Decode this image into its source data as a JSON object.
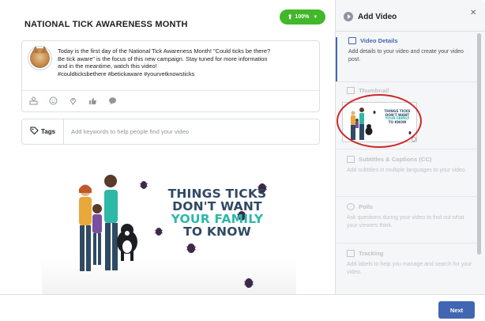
{
  "post": {
    "title": "NATIONAL TICK AWARENESS MONTH",
    "upload_progress": "100%",
    "upload_progress_value": 1.0,
    "text_lines": [
      "Today is the first day of the National Tick Awareness Month! \"Could ticks be there?",
      "Be tick aware\" is the focus of this new campaign. Stay tuned for more information",
      "and in the meantime, watch this video!",
      "#couldticksbethere #betickaware #yourvetknowsticks"
    ],
    "compose_icons": [
      "tag-people-icon",
      "feeling-icon",
      "location-icon",
      "thumbs-up-icon",
      "messenger-icon"
    ]
  },
  "tags": {
    "label": "Tags",
    "placeholder": "Add keywords to help people find your video"
  },
  "video": {
    "line1": "THINGS TICKS",
    "line2": "DON'T WANT",
    "line3": "YOUR FAMILY",
    "line4": "TO KNOW"
  },
  "sidebar": {
    "title": "Add Video",
    "steps": [
      {
        "label": "Video Details",
        "description": "Add details to your video and create your video post.",
        "state": "active",
        "icon": "video-details-icon"
      },
      {
        "label": "Thumbnail",
        "description": "",
        "state": "inactive",
        "icon": "thumbnail-icon"
      },
      {
        "label": "Subtitles & Captions (CC)",
        "description": "Add subtitles in multiple languages to your video.",
        "state": "inactive",
        "icon": "subtitles-icon"
      },
      {
        "label": "Polls",
        "description": "Ask questions during your video to find out what your viewers think.",
        "state": "inactive",
        "icon": "polls-icon"
      },
      {
        "label": "Tracking",
        "description": "Add labels to help you manage and search for your video.",
        "state": "inactive",
        "icon": "tracking-icon"
      }
    ],
    "thumbnail": {
      "line1": "THINGS TICKS",
      "line2": "DON'T WANT",
      "line3": "YOUR FAMILY",
      "line4": "TO KNOW"
    }
  },
  "footer": {
    "next_label": "Next"
  },
  "colors": {
    "primary": "#4267b2",
    "success": "#42b72a",
    "highlight_ring": "#d0262a",
    "navy_text": "#2f4a63",
    "teal_text": "#2eb8a8"
  }
}
